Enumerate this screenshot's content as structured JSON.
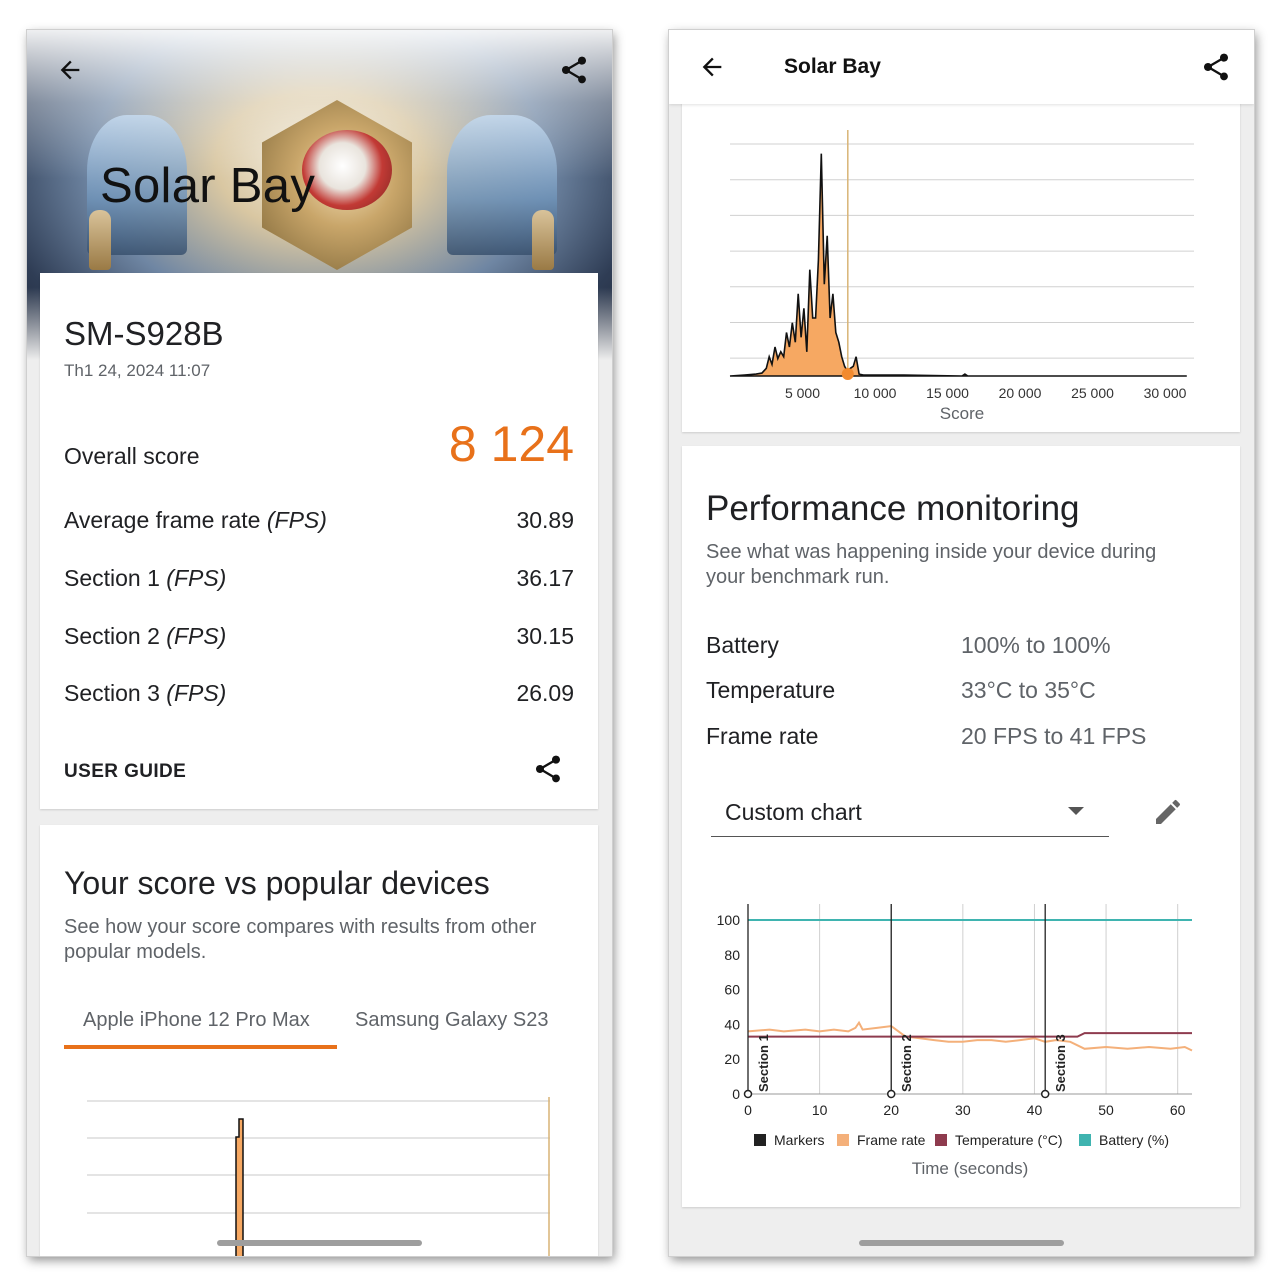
{
  "left": {
    "hero_title": "Solar Bay",
    "device_name": "SM-S928B",
    "date": "Th1 24, 2024 11:07",
    "overall_label": "Overall score",
    "overall_value": "8 124",
    "metrics": [
      {
        "label": "Average frame rate",
        "unit": "(FPS)",
        "value": "30.89"
      },
      {
        "label": "Section 1",
        "unit": "(FPS)",
        "value": "36.17"
      },
      {
        "label": "Section 2",
        "unit": "(FPS)",
        "value": "30.15"
      },
      {
        "label": "Section 3",
        "unit": "(FPS)",
        "value": "26.09"
      }
    ],
    "user_guide": "USER GUIDE",
    "compare_title": "Your score vs popular devices",
    "compare_desc_1": "See how your score compares with results from other",
    "compare_desc_2": "popular models.",
    "tabs": [
      "Apple iPhone 12 Pro Max",
      "Samsung Galaxy S23"
    ],
    "active_tab": 0
  },
  "right": {
    "appbar_title": "Solar Bay",
    "histogram_xlabel": "Score",
    "histogram_ticks": [
      "5 000",
      "10 000",
      "15 000",
      "20 000",
      "25 000",
      "30 000"
    ],
    "perf_title": "Performance monitoring",
    "perf_desc_1": "See what was happening inside your device during",
    "perf_desc_2": "your benchmark run.",
    "stats": [
      {
        "label": "Battery",
        "value": "100% to 100%"
      },
      {
        "label": "Temperature",
        "value": "33°C to 35°C"
      },
      {
        "label": "Frame rate",
        "value": "20 FPS to 41 FPS"
      }
    ],
    "dropdown_value": "Custom chart",
    "chart_xlabel": "Time (seconds)",
    "legend": [
      "Markers",
      "Frame rate",
      "Temperature (°C)",
      "Battery (%)"
    ],
    "section_markers": [
      "Section 1",
      "Section 2",
      "Section 3"
    ]
  },
  "colors": {
    "accent": "#e8711a",
    "histogram_fill": "#f6a862",
    "frame_rate": "#f4b07a",
    "temperature": "#8e3b4e",
    "battery": "#3fb4b0",
    "markers": "#222222",
    "tab_underline": "#e8711a"
  },
  "icons": [
    "back-arrow-icon",
    "share-icon",
    "dropdown-arrow-icon",
    "pencil-edit-icon"
  ],
  "chart_data": [
    {
      "type": "area",
      "title": "",
      "xlabel": "Score",
      "ylabel": "",
      "xlim": [
        0,
        32000
      ],
      "x_ticks": [
        5000,
        10000,
        15000,
        20000,
        25000,
        30000
      ],
      "marker_x": 8124,
      "grid": true,
      "series": [
        {
          "x": [
            0,
            1000,
            1800,
            2200,
            2500,
            2700,
            2900,
            3100,
            3300,
            3500,
            3700,
            3900,
            4100,
            4300,
            4500,
            4700,
            4900,
            5100,
            5300,
            5500,
            5700,
            5900,
            6100,
            6300,
            6500,
            6700,
            6900,
            7100,
            7300,
            7500,
            7700,
            7900,
            8100,
            8300,
            8500,
            8700,
            8900,
            9200,
            9500,
            10000,
            12000,
            16000,
            16200,
            16400,
            20000,
            25000,
            30000,
            31500
          ],
          "y": [
            0,
            1,
            2,
            3,
            8,
            20,
            12,
            30,
            18,
            25,
            20,
            45,
            30,
            55,
            35,
            85,
            40,
            70,
            25,
            110,
            60,
            60,
            120,
            230,
            95,
            145,
            60,
            85,
            45,
            35,
            20,
            10,
            5,
            8,
            10,
            20,
            2,
            1,
            1,
            1,
            1,
            0,
            2,
            0,
            0,
            0,
            0,
            0
          ]
        }
      ]
    },
    {
      "type": "line",
      "title": "",
      "xlabel": "Time (seconds)",
      "xlim": [
        0,
        62
      ],
      "ylim": [
        0,
        100
      ],
      "x_ticks": [
        0,
        10,
        20,
        30,
        40,
        50,
        60
      ],
      "y_ticks": [
        0,
        20,
        40,
        60,
        80,
        100
      ],
      "grid": true,
      "legend_position": "bottom",
      "markers": [
        {
          "name": "Section 1",
          "x": 0
        },
        {
          "name": "Section 2",
          "x": 20
        },
        {
          "name": "Section 3",
          "x": 41.5
        }
      ],
      "series": [
        {
          "name": "Frame rate",
          "x": [
            0,
            3,
            5,
            8,
            10,
            12,
            14,
            15,
            15.5,
            16,
            18,
            20,
            22,
            24,
            26,
            28,
            30,
            32,
            34,
            36,
            38,
            40,
            41.5,
            43,
            45,
            47,
            50,
            53,
            56,
            59,
            61,
            62
          ],
          "y": [
            36,
            37,
            36,
            37,
            36,
            37,
            36,
            38,
            41,
            37,
            38,
            39,
            33,
            32,
            31,
            30,
            30,
            31,
            31,
            30,
            31,
            32,
            30,
            31,
            30,
            26,
            27,
            26,
            27,
            26,
            27,
            25
          ]
        },
        {
          "name": "Temperature (°C)",
          "x": [
            0,
            46,
            47,
            62
          ],
          "y": [
            33,
            33,
            35,
            35
          ]
        },
        {
          "name": "Battery (%)",
          "x": [
            0,
            62
          ],
          "y": [
            100,
            100
          ]
        }
      ]
    }
  ]
}
